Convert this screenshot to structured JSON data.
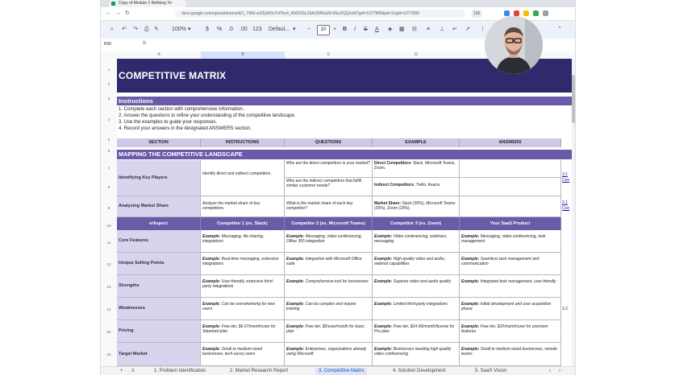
{
  "browser": {
    "tab_title": "Copy of Module 2 Refining Yo",
    "url": "docs.google.com/spreadsheets/d/1_YWd-w1I5yM3uYd7bo4_ANDSSLZbAIZMRaZ4-kNxJIQQ/edit?gid=1077889&pli=1#gid=1077889",
    "zoom_badge": "196"
  },
  "toolbar": {
    "zoom": "100%",
    "currency": "$",
    "percent": "%",
    "dec_minus": ".0",
    "dec_plus": ".00",
    "number_format": "123",
    "font": "Defaul...",
    "font_size": "10"
  },
  "formula_bar": {
    "name_box": "B98",
    "fx": "fx"
  },
  "columns": [
    "A",
    "B",
    "C",
    "D",
    "E"
  ],
  "rows": [
    "1",
    "2",
    "3",
    "4",
    "5",
    "6",
    "7",
    "8",
    "9",
    "10",
    "11",
    "12",
    "13",
    "14",
    "15",
    "16"
  ],
  "sheet": {
    "title": "COMPETITIVE MATRIX",
    "instructions_heading": "Instructions",
    "instructions": [
      "1. Complete each section with comprehensive information.",
      "2. Answer the questions to refine your understanding of the competitive landscape.",
      "3. Use the examples to guide your responses.",
      "4. Record your answers in the designated ANSWERS section."
    ],
    "headers": [
      "SECTION",
      "INSTRUCTIONS",
      "QUESTIONS",
      "EXAMPLE",
      "ANSWERS"
    ],
    "mapping_heading": "MAPPING THE COMPETITIVE LANDSCAPE",
    "key_players": {
      "label": "Identifying Key Players",
      "instruction": "Identify direct and indirect competitors.",
      "q1": "Who are the direct competitors in your market?",
      "q2": "Who are the indirect competitors that fulfill similar customer needs?",
      "ex1_bold": "Direct Competitors:",
      "ex1": " Slack, Microsoft Teams, Zoom.",
      "ex2_bold": "Indirect Competitors:",
      "ex2": " Trello, Asana."
    },
    "market_share": {
      "label": "Analyzing Market Share",
      "instruction": "Analyze the market share of key competitors.",
      "question": "What is the market share of each key competitor?",
      "ex_bold": "Market Share:",
      "ex": " Slack (30%), Microsoft Teams (25%), Zoom (20%)."
    },
    "side_refs": [
      "3.1",
      "Con",
      "3.1",
      "Con",
      "3.2."
    ],
    "matrix_headers": [
      "e/Aspect",
      "Competitor 1 (ex. Slack)",
      "Competitor 2 (ex. Microsoft Teams)",
      "Competitor 3 (ex. Zoom)",
      "Your SaaS Product"
    ],
    "matrix_rows": [
      {
        "label": "Core Features",
        "c1": "Messaging, file sharing, integrations",
        "c2": "Messaging, video conferencing, Office 365 integration",
        "c3": "Video conferencing, webinars, messaging",
        "c4": "Messaging, video conferencing, task management"
      },
      {
        "label": "Unique Selling Points",
        "c1": "Real-time messaging, extensive integrations",
        "c2": "Integration with Microsoft Office suite",
        "c3": "High-quality video and audio, webinar capabilities",
        "c4": "Seamless task management and communication"
      },
      {
        "label": "Strengths",
        "c1": "User-friendly, extensive third-party integrations",
        "c2": "Comprehensive tool for businesses",
        "c3": "Superior video and audio quality",
        "c4": "Integrated task management, user-friendly"
      },
      {
        "label": "Weaknesses",
        "c1": "Can be overwhelming for new users",
        "c2": "Can be complex and require training",
        "c3": "Limited third-party integrations",
        "c4": "Initial development and user acquisition phase"
      },
      {
        "label": "Pricing",
        "c1": "Free tier, $6.67/month/user for Standard plan",
        "c2": "Free tier, $5/user/month for basic plan",
        "c3": "Free tier, $14.99/month/license for Pro plan",
        "c4": "Free tier, $10/month/user for premium features"
      },
      {
        "label": "Target Market",
        "c1": "Small to medium-sized businesses, tech-savvy users",
        "c2": "Enterprises, organizations already using Microsoft",
        "c3": "Businesses needing high-quality video conferencing",
        "c4": "Small to medium-sized businesses, remote teams"
      }
    ],
    "example_prefix": "Example:"
  },
  "sheet_tabs": [
    "1. Problem Identification",
    "2. Market Research Report",
    "3. Competitive Matrix",
    "4. Solution Development",
    "5. SaaS Vision"
  ],
  "active_tab_index": 2
}
